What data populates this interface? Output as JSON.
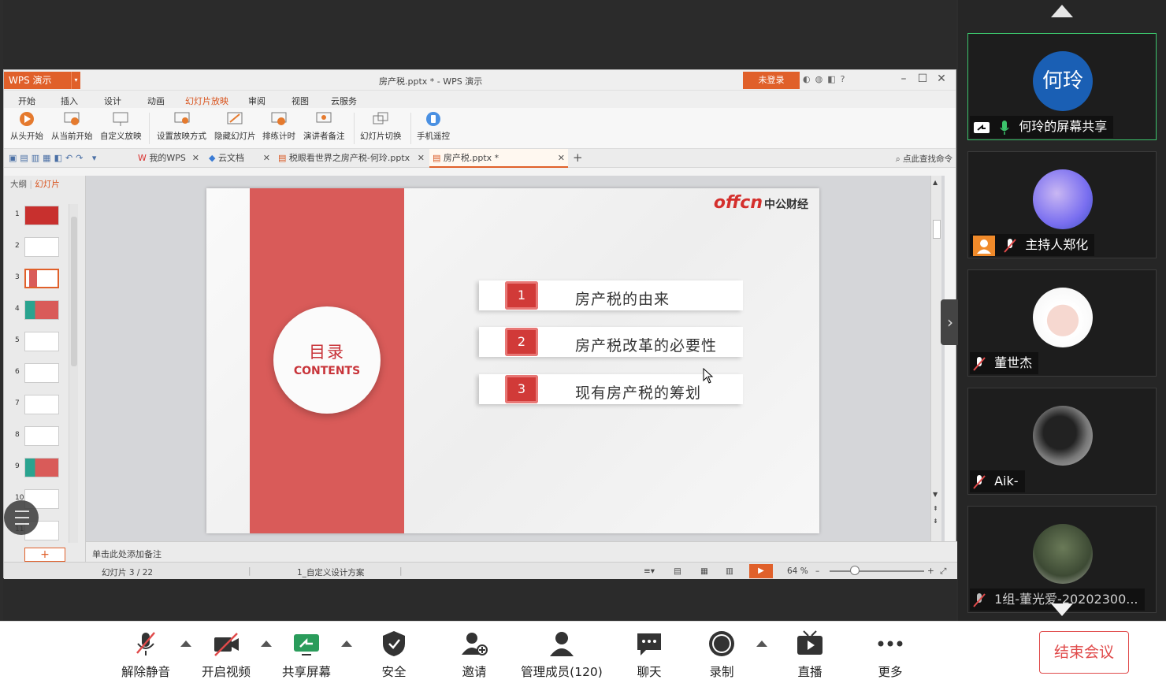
{
  "wps": {
    "app_name": "WPS 演示",
    "doc_title": "房产税.pptx * - WPS 演示",
    "login": "未登录",
    "menu": [
      "开始",
      "插入",
      "设计",
      "动画",
      "幻灯片放映",
      "审阅",
      "视图",
      "云服务"
    ],
    "ribbon": [
      "从头开始",
      "从当前开始",
      "自定义放映",
      "设置放映方式",
      "隐藏幻灯片",
      "排练计时",
      "演讲者备注",
      "幻灯片切换",
      "手机遥控"
    ],
    "tabs": [
      "我的WPS",
      "云文档",
      "税眼看世界之房产税-何玲.pptx",
      "房产税.pptx *"
    ],
    "search_cmd": "点此查找命令",
    "sidebar_tabs": [
      "大纲",
      "幻灯片"
    ],
    "thumb_numbers": [
      "1",
      "2",
      "3",
      "4",
      "5",
      "6",
      "7",
      "8",
      "9",
      "10",
      "11"
    ],
    "add_slide": "+",
    "notes_placeholder": "单击此处添加备注",
    "status_slide": "幻灯片 3 / 22",
    "status_design": "1_自定义设计方案",
    "zoom": "64 %"
  },
  "slide": {
    "logo_en": "offcn",
    "logo_cn": "中公财经",
    "toc_cn": "目录",
    "toc_en": "CONTENTS",
    "items": [
      {
        "num": "1",
        "text": "房产税的由来"
      },
      {
        "num": "2",
        "text": "房产税改革的必要性"
      },
      {
        "num": "3",
        "text": "现有房产税的筹划"
      }
    ]
  },
  "participants": [
    {
      "name": "何玲的屏幕共享",
      "avatar_text": "何玲",
      "mic": "on"
    },
    {
      "name": "主持人郑化",
      "mic": "muted"
    },
    {
      "name": "董世杰",
      "mic": "muted"
    },
    {
      "name": "Aik-",
      "mic": "muted"
    },
    {
      "name": "1组-董光爱-20202300...",
      "mic": "muted"
    }
  ],
  "toolbar": {
    "unmute": "解除静音",
    "video": "开启视频",
    "share": "共享屏幕",
    "security": "安全",
    "invite": "邀请",
    "members": "管理成员(120)",
    "chat": "聊天",
    "record": "录制",
    "live": "直播",
    "more": "更多",
    "end": "结束会议"
  },
  "colors": {
    "accent": "#e0602a",
    "slide_red": "#d95b59",
    "end_red": "#e04a4a",
    "active_green": "#3cc46c"
  }
}
